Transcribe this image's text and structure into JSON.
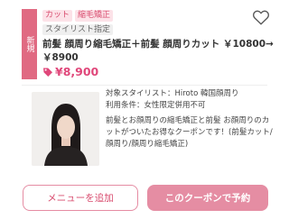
{
  "coupon": {
    "ribbon": "新規",
    "tags": [
      "カット",
      "縮毛矯正"
    ],
    "stylist_tag": "スタイリスト指定",
    "title_lines": [
      "前髪 顔周り縮毛矯正＋前髪 顔周りカット ￥10800→",
      "￥8900"
    ],
    "price": "8,900",
    "stylist_line": "対象スタイリスト：Hiroto 韓国顔周り",
    "conditions_line": "利用条件：女性限定併用不可",
    "description_lines": [
      "前髪とお顔周りの縮毛矯正と前髪 お顔周りのカ",
      "ットがついたお得なクーポンです！(前髪カット/",
      "顔周り/顔周り縮毛矯正)"
    ]
  },
  "buttons": {
    "add_menu": "メニューを追加",
    "book": "このクーポンで予約"
  },
  "colors": {
    "accent_pink": "#e0477a",
    "ribbon": "#e06a82",
    "button_pink": "#e58da3"
  },
  "icons": [
    "heart-icon",
    "price-tag-icon"
  ]
}
